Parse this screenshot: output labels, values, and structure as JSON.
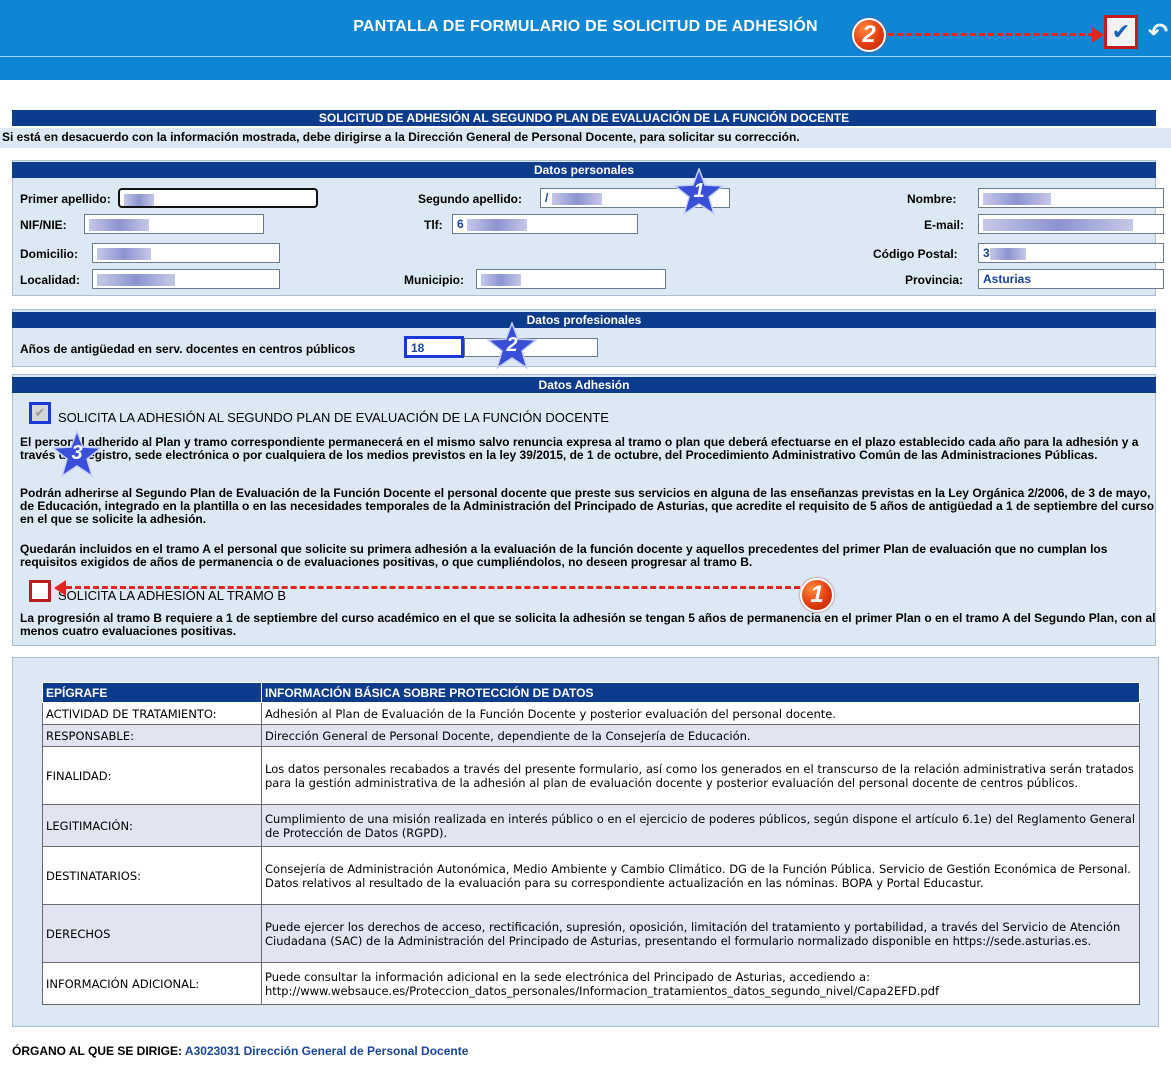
{
  "header": {
    "title": "PANTALLA DE FORMULARIO DE SOLICITUD DE ADHESIÓN",
    "save_icon": "check-icon",
    "undo_icon": "undo-icon",
    "callout_2": "2"
  },
  "form": {
    "title": "SOLICITUD DE ADHESIÓN AL SEGUNDO PLAN DE EVALUACIÓN DE LA FUNCIÓN DOCENTE",
    "notice": "Si está en desacuerdo con la información mostrada, debe dirigirse a la Dirección General de Personal Docente, para solicitar su corrección."
  },
  "personal": {
    "heading": "Datos personales",
    "star": "1",
    "primer_apellido_label": "Primer apellido:",
    "segundo_apellido_label": "Segundo apellido:",
    "segundo_apellido_value": "/",
    "nombre_label": "Nombre:",
    "nif_label": "NIF/NIE:",
    "tlf_label": "Tlf:",
    "tlf_value": "6",
    "email_label": "E-mail:",
    "domicilio_label": "Domicilio:",
    "cp_label": "Código Postal:",
    "cp_value": "3",
    "localidad_label": "Localidad:",
    "municipio_label": "Municipio:",
    "provincia_label": "Provincia:",
    "provincia_value": "Asturias"
  },
  "profesional": {
    "heading": "Datos profesionales",
    "star": "2",
    "antiguedad_label": "Años de antigüedad en serv. docentes en centros públicos",
    "antiguedad_value": "18"
  },
  "adhesion": {
    "heading": "Datos Adhesión",
    "star": "3",
    "check1_label": "SOLICITA LA ADHESIÓN AL SEGUNDO PLAN DE EVALUACIÓN DE LA FUNCIÓN DOCENTE",
    "check1_mark": "✔",
    "para1": "El personal adherido al Plan y tramo correspondiente permanecerá en el mismo salvo renuncia expresa al tramo o plan que deberá efectuarse en el plazo establecido cada año para la adhesión y a través del Registro, sede electrónica o por cualquiera de los medios previstos en la ley 39/2015, de 1 de octubre, del Procedimiento Administrativo Común de las Administraciones Públicas.",
    "para2": "Podrán adherirse al Segundo Plan de Evaluación de la Función Docente el personal docente que preste sus servicios en alguna de las enseñanzas previstas en la Ley Orgánica 2/2006, de 3 de mayo, de Educación, integrado en la plantilla o en las necesidades temporales de la Administración del Principado de Asturias, que acredite el requisito de 5 años de antigüedad a 1 de septiembre del curso en el que se solicite la adhesión.",
    "para3": "Quedarán incluidos en el tramo A el personal que solicite su primera adhesión a la evaluación de la función docente y aquellos precedentes del primer Plan de evaluación que no cumplan los requisitos exigidos de años de permanencia o de evaluaciones positivas, o que cumpliéndolos, no deseen progresar al tramo B.",
    "check2_label": "SOLICITA LA ADHESIÓN AL TRAMO B",
    "callout_1": "1",
    "para4": "La progresión al tramo B requiere a 1 de septiembre del curso académico en el que se solicita la adhesión se tengan 5 años de permanencia en el primer Plan o en el tramo A del Segundo Plan, con al menos cuatro evaluaciones positivas."
  },
  "lopd": {
    "col1": "EPÍGRAFE",
    "col2": "INFORMACIÓN BÁSICA SOBRE PROTECCIÓN DE DATOS",
    "rows": [
      {
        "k": "ACTIVIDAD DE TRATAMIENTO:",
        "v": "Adhesión al Plan de Evaluación de la Función Docente y posterior evaluación del personal docente."
      },
      {
        "k": "RESPONSABLE:",
        "v": "Dirección General de Personal Docente, dependiente de la Consejería de Educación."
      },
      {
        "k": "FINALIDAD:",
        "v": "Los datos personales recabados a través del presente formulario, así como los generados en el transcurso de la relación administrativa serán tratados para la gestión administrativa de la adhesión al plan de evaluación docente y posterior evaluación del personal docente de centros públicos."
      },
      {
        "k": "LEGITIMACIÓN:",
        "v": "Cumplimiento de una misión realizada en interés público o en el ejercicio de poderes públicos, según dispone el artículo 6.1e) del Reglamento General de Protección de Datos (RGPD)."
      },
      {
        "k": "DESTINATARIOS:",
        "v": "Consejería de Administración Autonómica, Medio Ambiente y Cambio Climático. DG de la Función Pública. Servicio de Gestión Económica de Personal. Datos relativos al resultado de la evaluación para su correspondiente actualización en las nóminas. BOPA y Portal Educastur."
      },
      {
        "k": "DERECHOS",
        "v": "Puede ejercer los derechos de acceso, rectificación, supresión, oposición, limitación del tratamiento y portabilidad, a través del Servicio de Atención Ciudadana (SAC) de la Administración del Principado de Asturias, presentando el formulario normalizado disponible en https://sede.asturias.es."
      },
      {
        "k": "INFORMACIÓN ADICIONAL:",
        "v": "Puede consultar la información adicional en la sede electrónica del Principado de Asturias, accediendo a: http://www.websauce.es/Proteccion_datos_personales/Informacion_tratamientos_datos_segundo_nivel/Capa2EFD.pdf"
      }
    ]
  },
  "footer": {
    "label": "ÓRGANO AL QUE SE DIRIGE:",
    "value": "A3023031 Dirección General de Personal Docente"
  },
  "colors": {
    "topbar": "#0f86d4",
    "section_header": "#0e3c8c",
    "panel": "#dce9f4",
    "callout_red": "#e33b10",
    "star_blue": "#3a4fd8"
  }
}
